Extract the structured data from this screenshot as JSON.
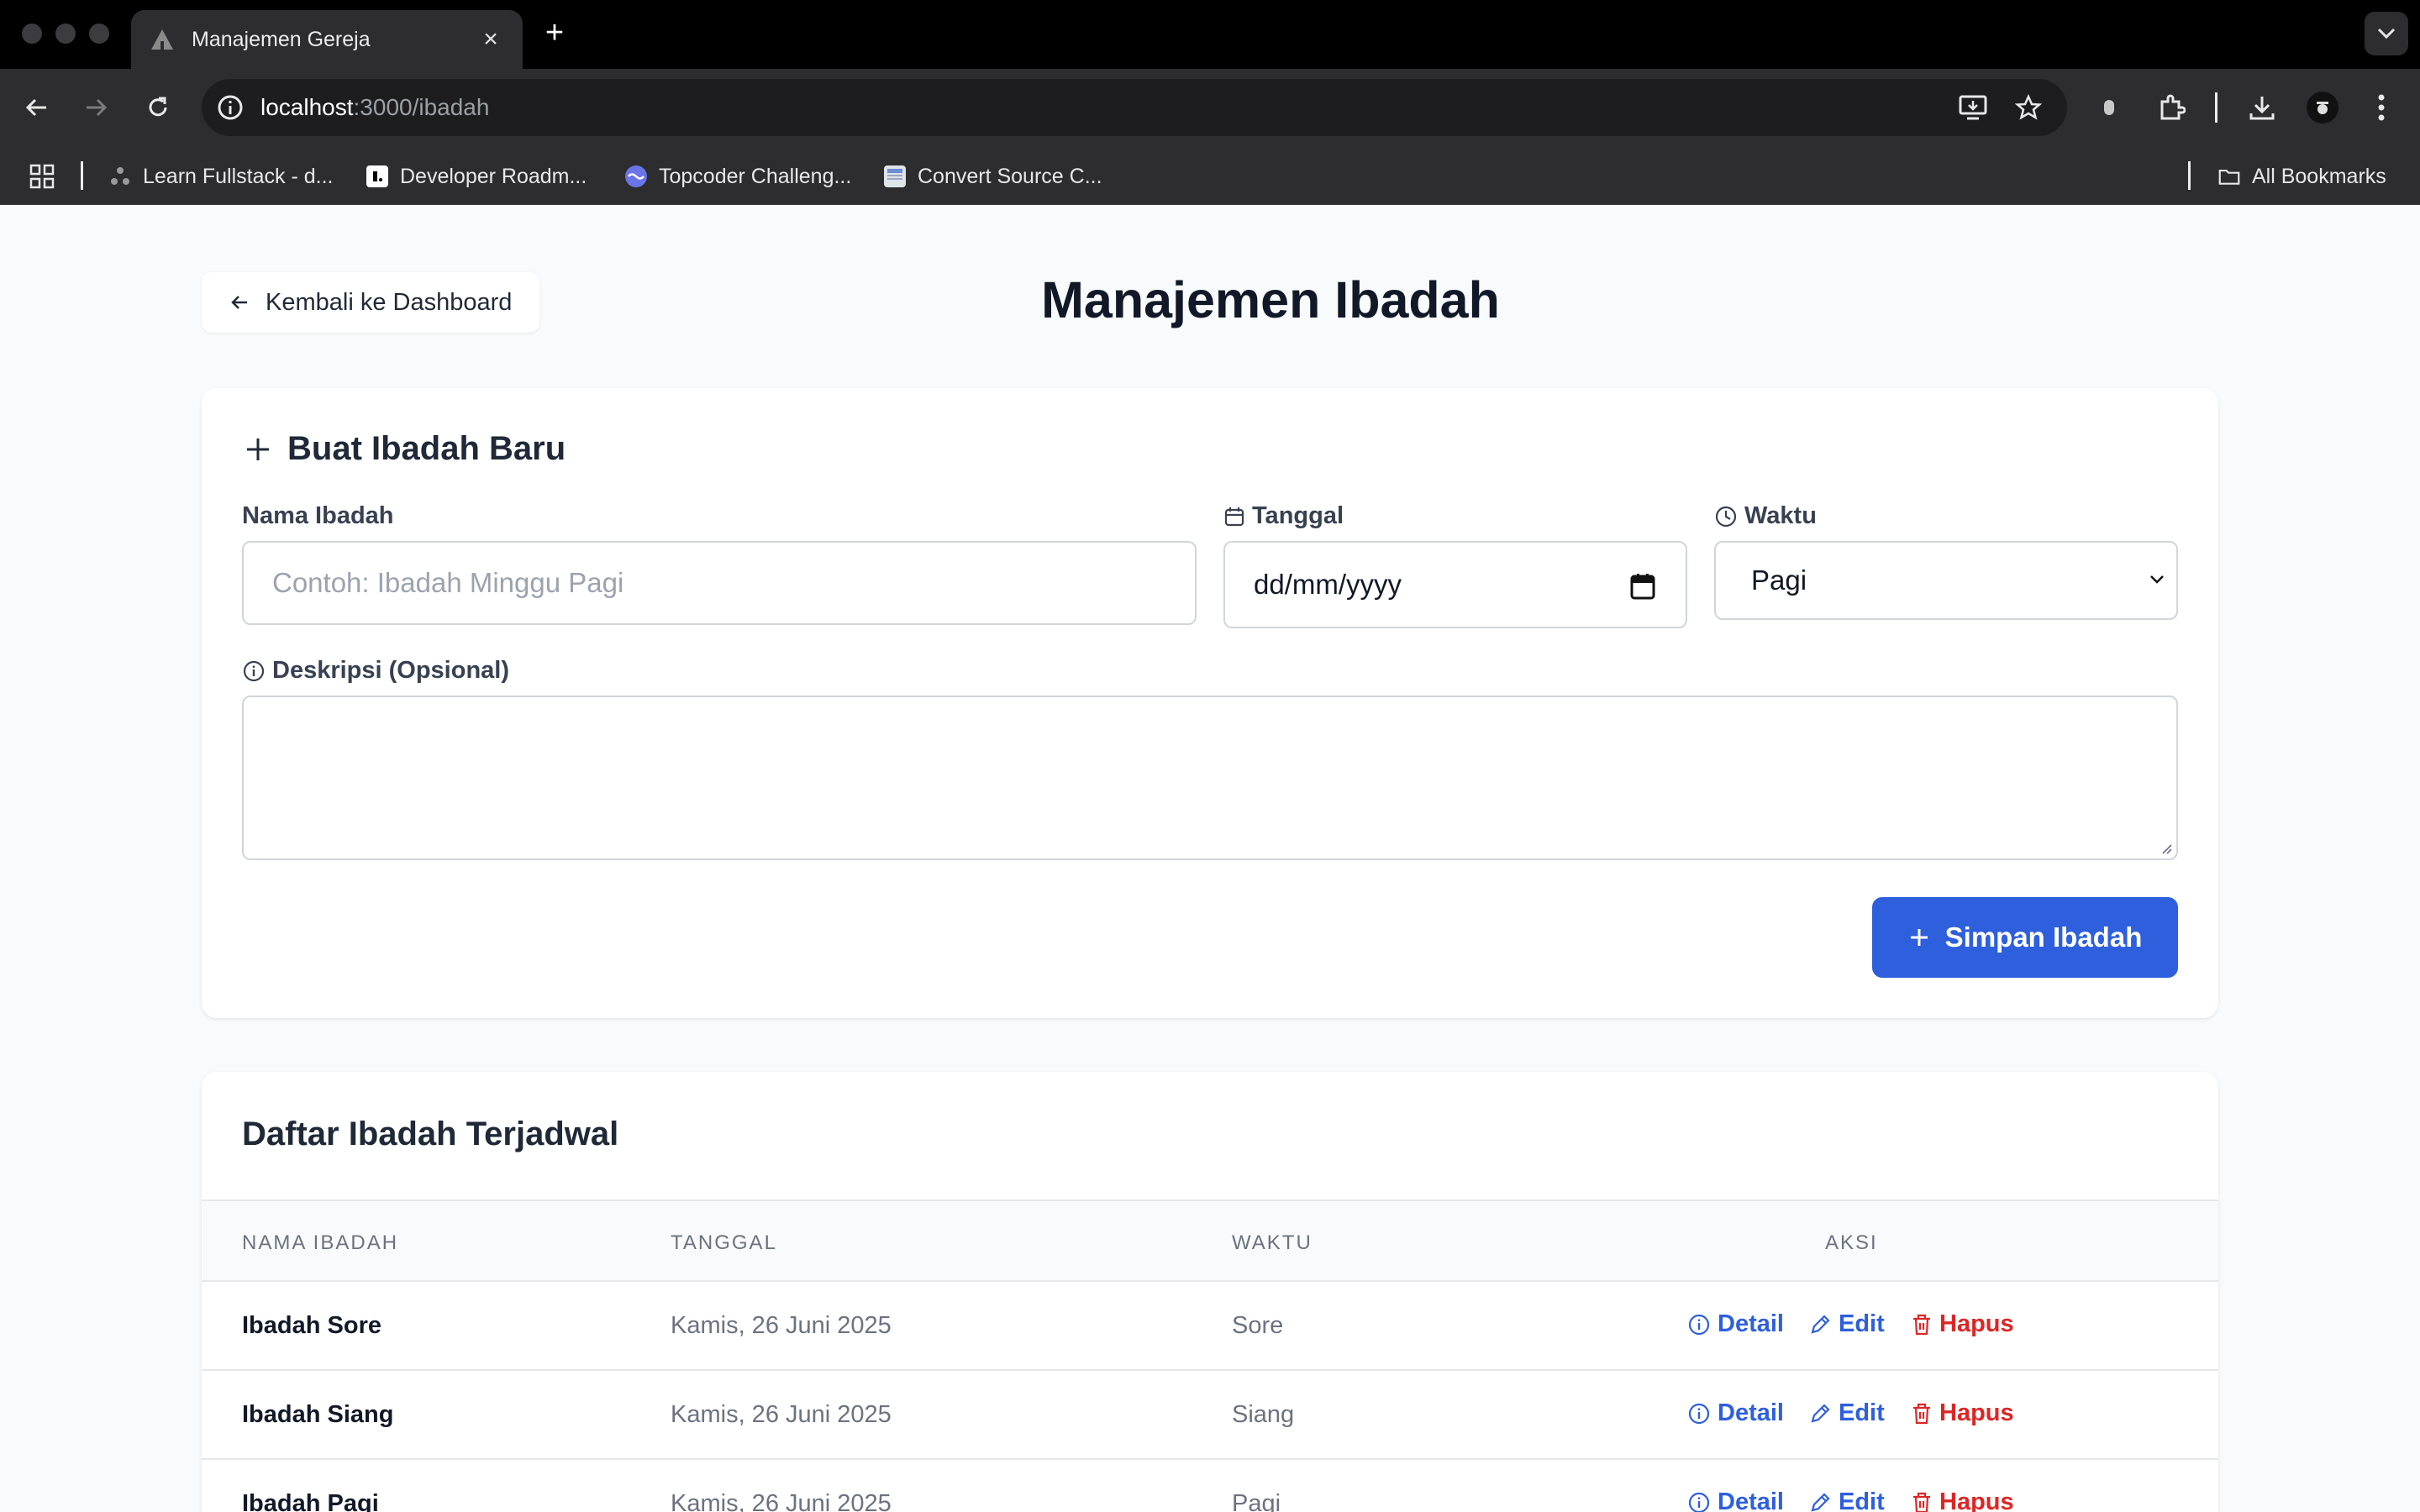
{
  "browser": {
    "tab_title": "Manajemen Gereja",
    "tab_close": "×",
    "new_tab": "+",
    "url_host": "localhost",
    "url_path": ":3000/ibadah",
    "bookmarks": [
      {
        "label": "Learn Fullstack - d..."
      },
      {
        "label": "Developer Roadm..."
      },
      {
        "label": "Topcoder Challeng..."
      },
      {
        "label": "Convert Source C..."
      }
    ],
    "all_bookmarks": "All Bookmarks"
  },
  "header": {
    "back_label": "Kembali ke Dashboard",
    "title": "Manajemen Ibadah"
  },
  "form": {
    "title": "Buat Ibadah Baru",
    "name_label": "Nama Ibadah",
    "name_placeholder": "Contoh: Ibadah Minggu Pagi",
    "date_label": "Tanggal",
    "date_value": "dd/mm/yyyy",
    "time_label": "Waktu",
    "time_value": "Pagi",
    "desc_label": "Deskripsi (Opsional)",
    "desc_value": "",
    "submit_label": "Simpan Ibadah"
  },
  "list": {
    "title": "Daftar Ibadah Terjadwal",
    "columns": [
      "NAMA IBADAH",
      "TANGGAL",
      "WAKTU",
      "AKSI"
    ],
    "rows": [
      {
        "name": "Ibadah Sore",
        "date": "Kamis, 26 Juni 2025",
        "time": "Sore"
      },
      {
        "name": "Ibadah Siang",
        "date": "Kamis, 26 Juni 2025",
        "time": "Siang"
      },
      {
        "name": "Ibadah Pagi",
        "date": "Kamis, 26 Juni 2025",
        "time": "Pagi"
      }
    ],
    "actions": {
      "detail": "Detail",
      "edit": "Edit",
      "delete": "Hapus"
    }
  },
  "colors": {
    "primary": "#2e5fdc",
    "danger": "#dc2626",
    "page_bg": "#f9fafb"
  }
}
